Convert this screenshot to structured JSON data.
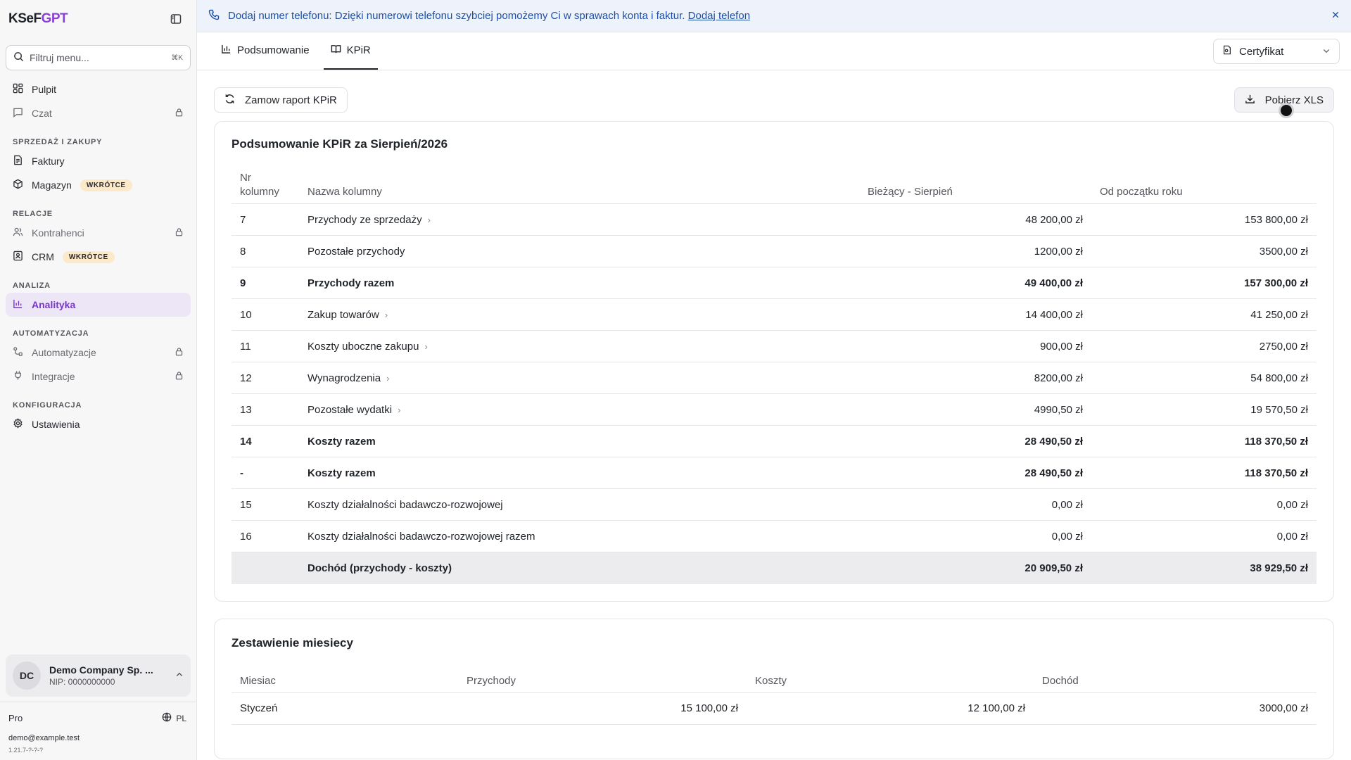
{
  "sidebar": {
    "logo_part1": "KSeF",
    "logo_part2": "GPT",
    "search_placeholder": "Filtruj menu...",
    "search_shortcut": "⌘K",
    "items_top": [
      {
        "label": "Pulpit"
      },
      {
        "label": "Czat"
      }
    ],
    "section_sales": "SPRZEDAŻ I ZAKUPY",
    "faktury": "Faktury",
    "magazyn": "Magazyn",
    "badge_soon": "WKRÓTCE",
    "section_relations": "RELACJE",
    "kontrahenci": "Kontrahenci",
    "crm": "CRM",
    "section_analysis": "ANALIZA",
    "analityka": "Analityka",
    "section_automation": "AUTOMATYZACJA",
    "automatyzacje": "Automatyzacje",
    "integracje": "Integracje",
    "section_config": "KONFIGURACJA",
    "ustawienia": "Ustawienia",
    "company_initials": "DC",
    "company_name": "Demo Company Sp. ...",
    "company_nip": "NIP: 0000000000",
    "plan": "Pro",
    "lang": "PL",
    "email": "demo@example.test",
    "version": "1.21.7-?-?-?"
  },
  "banner": {
    "text": "Dodaj numer telefonu: Dzięki numerowi telefonu szybciej pomożemy Ci w sprawach konta i faktur.",
    "link": "Dodaj telefon"
  },
  "tabs": {
    "summary": "Podsumowanie",
    "kpir": "KPiR"
  },
  "certificate": {
    "label": "Certyfikat"
  },
  "actions": {
    "order_report": "Zamow raport KPiR",
    "download_xls": "Pobierz XLS"
  },
  "summary": {
    "title": "Podsumowanie KPiR za Sierpień/2026",
    "headers": {
      "nr": "Nr kolumny",
      "name": "Nazwa kolumny",
      "current": "Bieżący - Sierpień",
      "ytd": "Od początku roku"
    },
    "rows": [
      {
        "nr": "7",
        "name": "Przychody ze sprzedaży",
        "current": "48 200,00 zł",
        "ytd": "153 800,00 zł",
        "chevron": "›"
      },
      {
        "nr": "8",
        "name": "Pozostałe przychody",
        "current": "1200,00 zł",
        "ytd": "3500,00 zł",
        "chevron": ""
      },
      {
        "nr": "9",
        "name": "Przychody razem",
        "current": "49 400,00 zł",
        "ytd": "157 300,00 zł",
        "chevron": ""
      },
      {
        "nr": "10",
        "name": "Zakup towarów",
        "current": "14 400,00 zł",
        "ytd": "41 250,00 zł",
        "chevron": "›"
      },
      {
        "nr": "11",
        "name": "Koszty uboczne zakupu",
        "current": "900,00 zł",
        "ytd": "2750,00 zł",
        "chevron": "›"
      },
      {
        "nr": "12",
        "name": "Wynagrodzenia",
        "current": "8200,00 zł",
        "ytd": "54 800,00 zł",
        "chevron": "›"
      },
      {
        "nr": "13",
        "name": "Pozostałe wydatki",
        "current": "4990,50 zł",
        "ytd": "19 570,50 zł",
        "chevron": "›"
      },
      {
        "nr": "14",
        "name": "Koszty razem",
        "current": "28 490,50 zł",
        "ytd": "118 370,50 zł",
        "chevron": ""
      },
      {
        "nr": "-",
        "name": "Koszty razem",
        "current": "28 490,50 zł",
        "ytd": "118 370,50 zł",
        "chevron": ""
      },
      {
        "nr": "15",
        "name": "Koszty działalności badawczo-rozwojowej",
        "current": "0,00 zł",
        "ytd": "0,00 zł",
        "chevron": ""
      },
      {
        "nr": "16",
        "name": "Koszty działalności badawczo-rozwojowej razem",
        "current": "0,00 zł",
        "ytd": "0,00 zł",
        "chevron": ""
      }
    ],
    "total": {
      "nr": "",
      "name": "Dochód (przychody - koszty)",
      "current": "20 909,50 zł",
      "ytd": "38 929,50 zł"
    }
  },
  "monthly": {
    "title": "Zestawienie miesiecy",
    "headers": {
      "month": "Miesiac",
      "income": "Przychody",
      "costs": "Koszty",
      "profit": "Dochód"
    },
    "rows": [
      {
        "month": "Styczeń",
        "income": "15 100,00 zł",
        "costs": "12 100,00 zł",
        "profit": "3000,00 zł"
      }
    ]
  }
}
